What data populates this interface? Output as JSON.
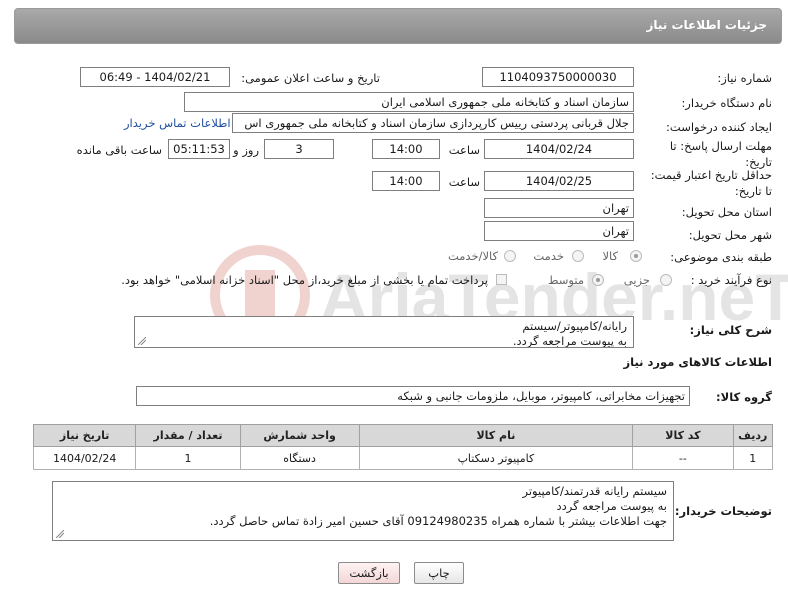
{
  "header": {
    "title": "جزئیات اطلاعات نیاز"
  },
  "labels": {
    "need_number": "شماره نیاز:",
    "announce_datetime": "تاریخ و ساعت اعلان عمومی:",
    "buyer_org": "نام دستگاه خریدار:",
    "creator": "ایجاد کننده درخواست:",
    "reply_deadline": "مهلت ارسال پاسخ: تا تاریخ:",
    "hour": "ساعت",
    "day_and": "روز و",
    "remaining": "ساعت باقی مانده",
    "price_validity": "حداقل تاریخ اعتبار قیمت: تا تاریخ:",
    "province": "استان محل تحویل:",
    "city": "شهر محل تحویل:",
    "category": "طبقه بندی موضوعی:",
    "process": "نوع فرآیند خرید :",
    "general_desc": "شرح کلی نیاز:",
    "goods_info": "اطلاعات کالاهای مورد نیاز",
    "goods_group": "گروه کالا:",
    "buyer_notes": "توضیحات خریدار:"
  },
  "values": {
    "need_number": "1104093750000030",
    "announce_datetime": "1404/02/21 - 06:49",
    "buyer_org": "سازمان اسناد و کتابخانه ملی جمهوری اسلامی ایران",
    "creator": "جلال قربانی پردستی رییس کارپردازی سازمان اسناد و کتابخانه ملی جمهوری اس",
    "contact_link": "اطلاعات تماس خریدار",
    "reply_date": "1404/02/24",
    "reply_time": "14:00",
    "days_left": "3",
    "time_left": "05:11:53",
    "price_date": "1404/02/25",
    "price_time": "14:00",
    "province": "تهران",
    "city": "تهران",
    "goods_group": "تجهیزات مخابراتی، کامپیوتر، موبایل، ملزومات جانبی و شبکه"
  },
  "category_options": {
    "goods": "کالا",
    "service": "خدمت",
    "goods_service": "کالا/خدمت"
  },
  "process_options": {
    "partial": "جزیی",
    "medium": "متوسط",
    "treasury_note": "پرداخت تمام یا بخشی از مبلغ خرید،از محل \"اسناد خزانه اسلامی\" خواهد بود."
  },
  "general_desc_text": {
    "line1": "رایانه/کامپیوتر/سیستم",
    "line2": "به پیوست مراجعه گردد."
  },
  "table": {
    "headers": {
      "row": "ردیف",
      "code": "کد کالا",
      "name": "نام کالا",
      "unit": "واحد شمارش",
      "qty": "تعداد / مقدار",
      "date": "تاریخ نیاز"
    },
    "rows": [
      {
        "row": "1",
        "code": "--",
        "name": "کامپیوتر دسکتاپ",
        "unit": "دستگاه",
        "qty": "1",
        "date": "1404/02/24"
      }
    ]
  },
  "buyer_notes_text": {
    "line1": "سیستم رایانه قدرتمند/کامپیوتر",
    "line2": "به پیوست مراجعه گردد",
    "line3": "جهت اطلاعات بیشتر با شماره همراه 09124980235 آقای حسین امیر زادة تماس حاصل گردد."
  },
  "buttons": {
    "print": "چاپ",
    "back": "بازگشت"
  },
  "watermark": {
    "text": "AriaTender.neT"
  },
  "colors": {
    "header_bg": "#9a9a9a",
    "link": "#1f4fa0",
    "back_button": "#f3d6d6"
  }
}
